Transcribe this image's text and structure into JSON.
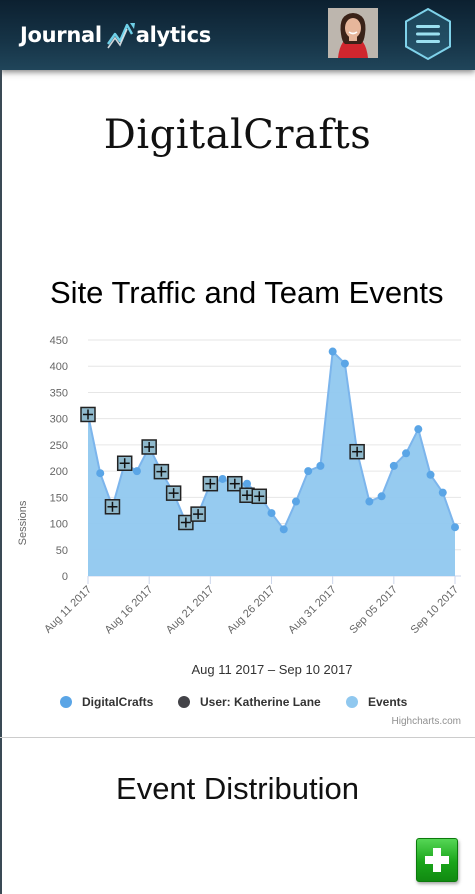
{
  "app": {
    "logo_part1": "Journal",
    "logo_part2": "alytics",
    "logo_icon": "trend-arrow-icon",
    "menu_icon": "hamburger-hexagon-icon",
    "avatar_alt": "User avatar"
  },
  "page": {
    "brand_title": "DigitalCrafts",
    "section_title": "Event Distribution",
    "add_icon": "plus-icon"
  },
  "colors": {
    "area_fill": "#90c8ef",
    "line": "#7cb5ec",
    "point": "#5aa5e6",
    "event_marker": "#8fb9cc",
    "user_series": "#434348",
    "add_button": "#1aa51a"
  },
  "chart_data": {
    "type": "area",
    "title": "Site Traffic and Team Events",
    "ylabel": "Sessions",
    "xlabel": "Aug 11 2017 – Sep 10 2017",
    "ylim": [
      0,
      450
    ],
    "yticks": [
      0,
      50,
      100,
      150,
      200,
      250,
      300,
      350,
      400,
      450
    ],
    "xticks": [
      "Aug 11 2017",
      "Aug 16 2017",
      "Aug 21 2017",
      "Aug 26 2017",
      "Aug 31 2017",
      "Sep 05 2017",
      "Sep 10 2017"
    ],
    "grid": true,
    "legend_position": "bottom",
    "credit": "Highcharts.com",
    "series": [
      {
        "name": "DigitalCrafts",
        "x": [
          "2017-08-11",
          "2017-08-12",
          "2017-08-13",
          "2017-08-14",
          "2017-08-15",
          "2017-08-16",
          "2017-08-17",
          "2017-08-18",
          "2017-08-19",
          "2017-08-20",
          "2017-08-21",
          "2017-08-22",
          "2017-08-23",
          "2017-08-24",
          "2017-08-25",
          "2017-08-26",
          "2017-08-27",
          "2017-08-28",
          "2017-08-29",
          "2017-08-30",
          "2017-08-31",
          "2017-09-01",
          "2017-09-02",
          "2017-09-03",
          "2017-09-04",
          "2017-09-05",
          "2017-09-06",
          "2017-09-07",
          "2017-09-08",
          "2017-09-09",
          "2017-09-10"
        ],
        "values": [
          308,
          196,
          132,
          215,
          200,
          246,
          199,
          158,
          102,
          118,
          176,
          185,
          176,
          176,
          154,
          120,
          89,
          142,
          200,
          210,
          428,
          405,
          237,
          142,
          152,
          210,
          234,
          280,
          193,
          159,
          93
        ]
      },
      {
        "name": "User: Katherine Lane",
        "x": [],
        "values": []
      },
      {
        "name": "Events",
        "x": [
          "2017-08-11",
          "2017-08-13",
          "2017-08-14",
          "2017-08-16",
          "2017-08-17",
          "2017-08-18",
          "2017-08-19",
          "2017-08-20",
          "2017-08-21",
          "2017-08-23",
          "2017-08-24",
          "2017-08-25",
          "2017-09-02"
        ],
        "values": [
          308,
          132,
          215,
          246,
          199,
          158,
          102,
          118,
          176,
          176,
          154,
          152,
          237
        ]
      }
    ]
  }
}
